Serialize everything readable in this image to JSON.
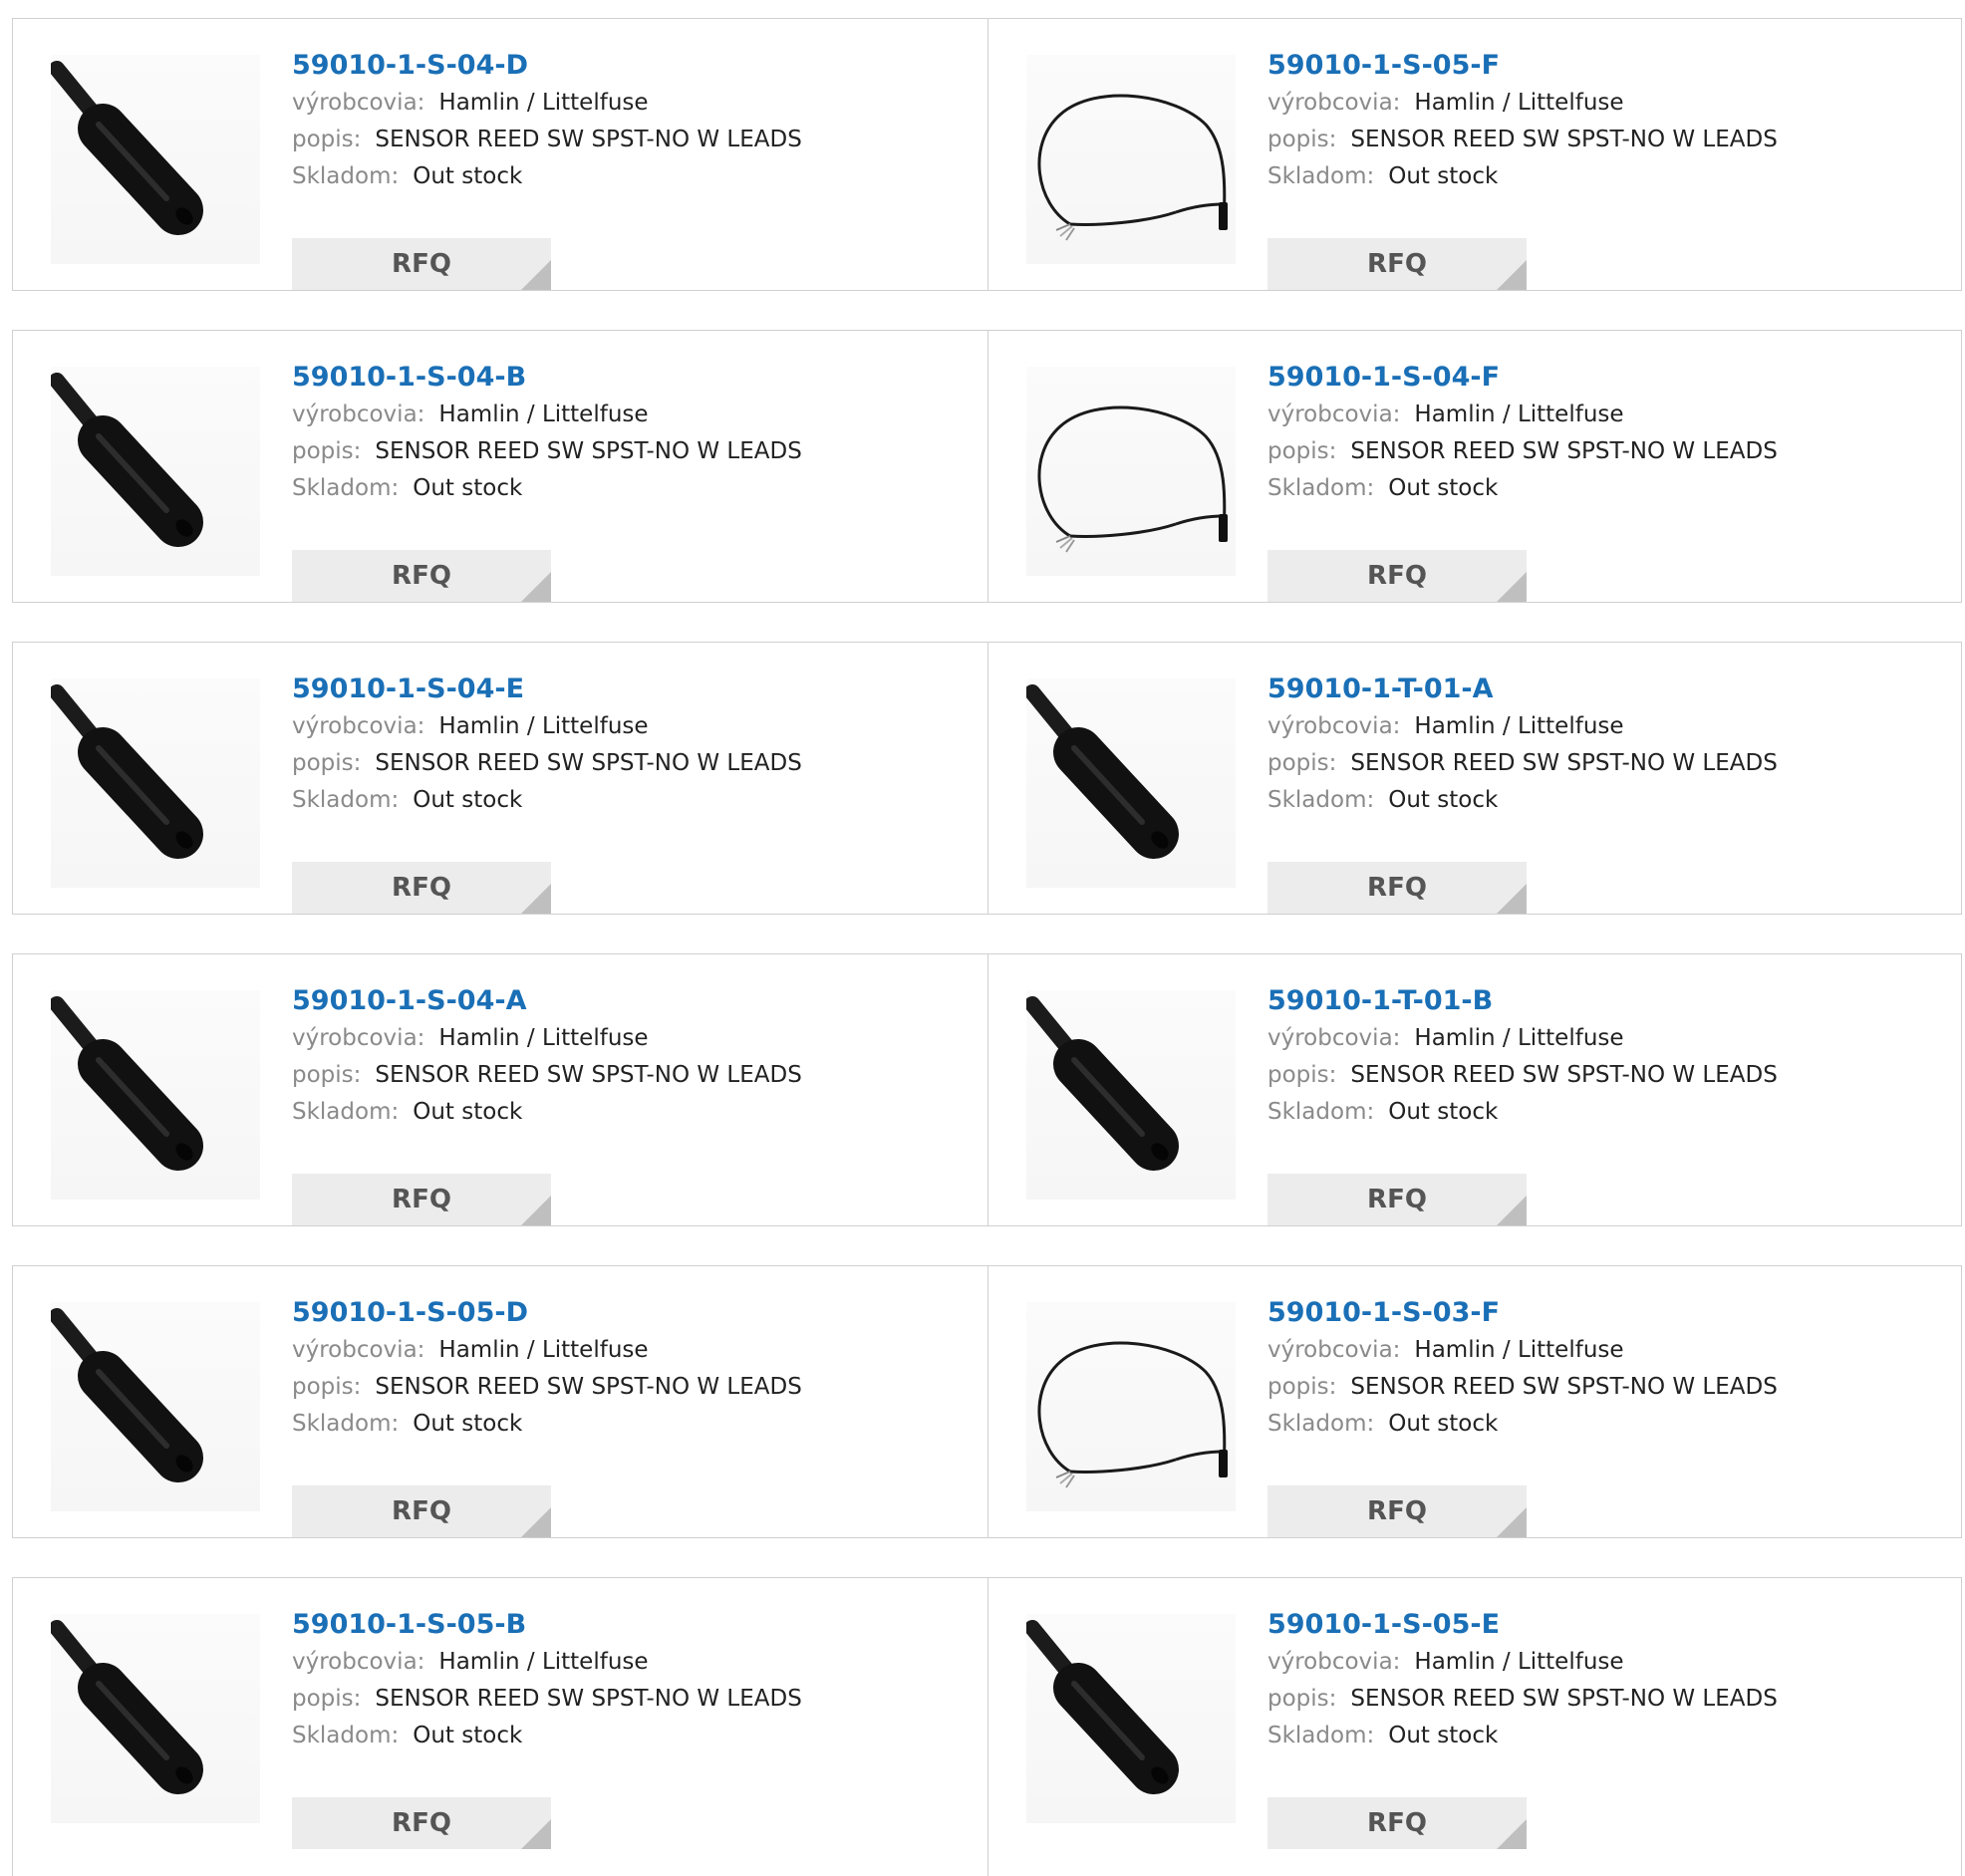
{
  "labels": {
    "manufacturer": "výrobcovia:",
    "description": "popis:",
    "stock": "Skladom:"
  },
  "colors": {
    "part_link": "#1a6fb6",
    "button_bg": "#ececec",
    "button_text": "#555555",
    "border": "#d0d0d0"
  },
  "rows": [
    {
      "left": {
        "part": "59010-1-S-04-D",
        "manufacturer": "Hamlin / Littelfuse",
        "description": "SENSOR REED SW SPST-NO W LEADS",
        "stock": "Out stock",
        "button": "RFQ",
        "image": "cylinder-sensor-icon"
      },
      "right": {
        "part": "59010-1-S-05-F",
        "manufacturer": "Hamlin / Littelfuse",
        "description": "SENSOR REED SW SPST-NO W LEADS",
        "stock": "Out stock",
        "button": "RFQ",
        "image": "cable-loop-sensor-icon"
      }
    },
    {
      "left": {
        "part": "59010-1-S-04-B",
        "manufacturer": "Hamlin / Littelfuse",
        "description": "SENSOR REED SW SPST-NO W LEADS",
        "stock": "Out stock",
        "button": "RFQ",
        "image": "cylinder-sensor-icon"
      },
      "right": {
        "part": "59010-1-S-04-F",
        "manufacturer": "Hamlin / Littelfuse",
        "description": "SENSOR REED SW SPST-NO W LEADS",
        "stock": "Out stock",
        "button": "RFQ",
        "image": "cable-loop-sensor-icon"
      }
    },
    {
      "left": {
        "part": "59010-1-S-04-E",
        "manufacturer": "Hamlin / Littelfuse",
        "description": "SENSOR REED SW SPST-NO W LEADS",
        "stock": "Out stock",
        "button": "RFQ",
        "image": "cylinder-sensor-icon"
      },
      "right": {
        "part": "59010-1-T-01-A",
        "manufacturer": "Hamlin / Littelfuse",
        "description": "SENSOR REED SW SPST-NO W LEADS",
        "stock": "Out stock",
        "button": "RFQ",
        "image": "cylinder-sensor-icon"
      }
    },
    {
      "left": {
        "part": "59010-1-S-04-A",
        "manufacturer": "Hamlin / Littelfuse",
        "description": "SENSOR REED SW SPST-NO W LEADS",
        "stock": "Out stock",
        "button": "RFQ",
        "image": "cylinder-sensor-icon"
      },
      "right": {
        "part": "59010-1-T-01-B",
        "manufacturer": "Hamlin / Littelfuse",
        "description": "SENSOR REED SW SPST-NO W LEADS",
        "stock": "Out stock",
        "button": "RFQ",
        "image": "cylinder-sensor-icon"
      }
    },
    {
      "left": {
        "part": "59010-1-S-05-D",
        "manufacturer": "Hamlin / Littelfuse",
        "description": "SENSOR REED SW SPST-NO W LEADS",
        "stock": "Out stock",
        "button": "RFQ",
        "image": "cylinder-sensor-icon"
      },
      "right": {
        "part": "59010-1-S-03-F",
        "manufacturer": "Hamlin / Littelfuse",
        "description": "SENSOR REED SW SPST-NO W LEADS",
        "stock": "Out stock",
        "button": "RFQ",
        "image": "cable-loop-sensor-icon"
      }
    },
    {
      "left": {
        "part": "59010-1-S-05-B",
        "manufacturer": "Hamlin / Littelfuse",
        "description": "SENSOR REED SW SPST-NO W LEADS",
        "stock": "Out stock",
        "button": "RFQ",
        "image": "cylinder-sensor-icon"
      },
      "right": {
        "part": "59010-1-S-05-E",
        "manufacturer": "Hamlin / Littelfuse",
        "description": "SENSOR REED SW SPST-NO W LEADS",
        "stock": "Out stock",
        "button": "RFQ",
        "image": "cylinder-sensor-icon"
      }
    }
  ]
}
